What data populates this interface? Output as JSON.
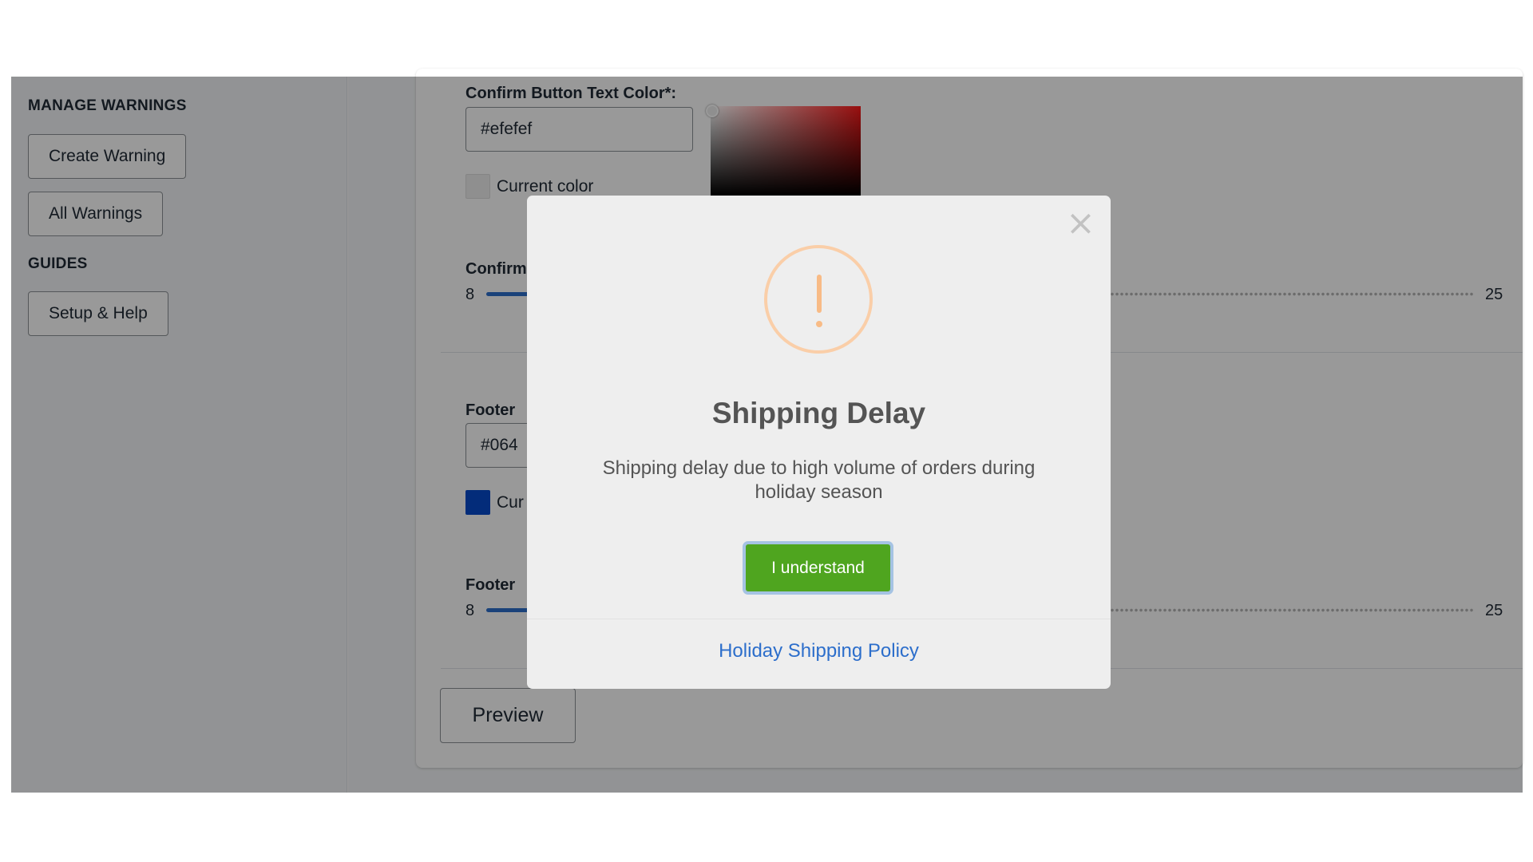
{
  "sidebar": {
    "manage_heading": "MANAGE WARNINGS",
    "create_warning": "Create Warning",
    "all_warnings": "All Warnings",
    "guides_heading": "GUIDES",
    "setup_help": "Setup & Help"
  },
  "form": {
    "confirm_text_color_label": "Confirm Button Text Color*:",
    "confirm_text_color_value": "#efefef",
    "current_color_label": "Current color",
    "confirm_text_size_label": "Confirm",
    "confirm_text_size_min": "8",
    "confirm_text_size_max": "25",
    "footer_color_label": "Footer",
    "footer_color_value": "#064",
    "footer_current_color_label": "Cur",
    "footer_text_size_label": "Footer",
    "footer_text_size_min": "8",
    "footer_text_size_max": "25",
    "preview_button": "Preview",
    "confirm_swatch_color": "#efefef",
    "footer_swatch_color": "#064acb"
  },
  "modal": {
    "icon": "warning-icon",
    "close_icon": "×",
    "title": "Shipping Delay",
    "message": "Shipping delay due to high volume of orders during holiday season",
    "confirm_button": "I understand",
    "footer_link": "Holiday Shipping Policy",
    "confirm_button_color": "#4fa51f",
    "link_color": "#2c6ecb"
  }
}
